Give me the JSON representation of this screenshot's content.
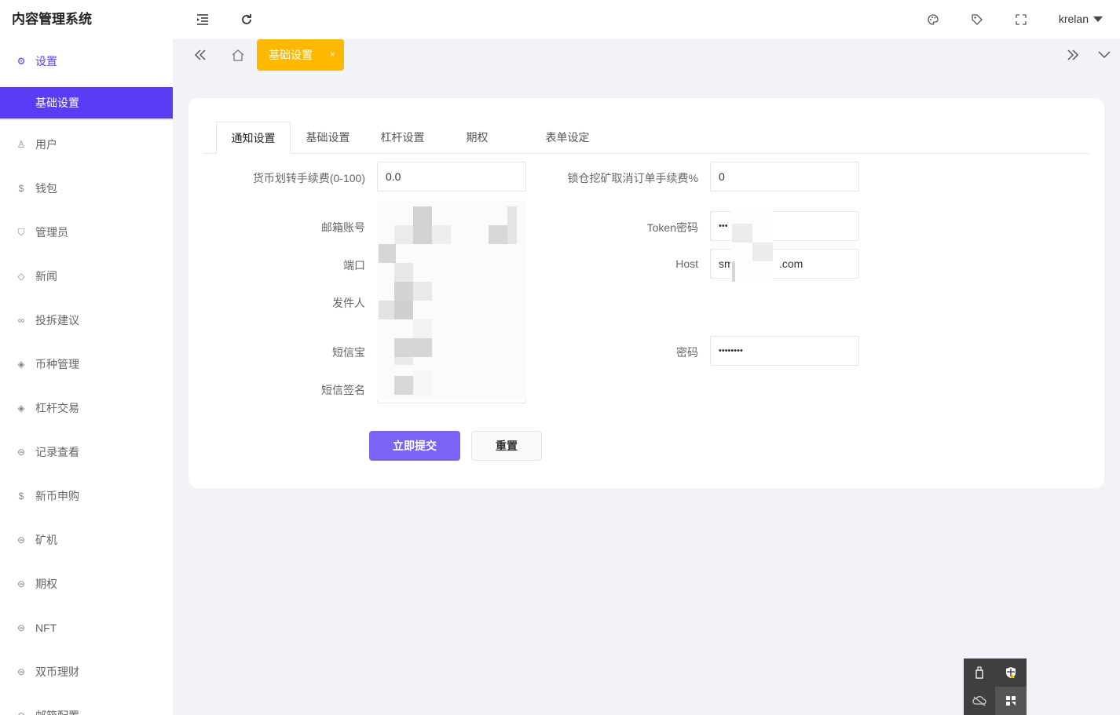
{
  "app": {
    "title": "内容管理系统"
  },
  "sidebar": {
    "top": {
      "label": "设置",
      "icon": "gear-icon"
    },
    "active_sub": "基础设置",
    "items": [
      {
        "label": "用户",
        "icon": "user-icon"
      },
      {
        "label": "钱包",
        "icon": "dollar-icon"
      },
      {
        "label": "管理员",
        "icon": "shield-icon"
      },
      {
        "label": "新闻",
        "icon": "tag-icon"
      },
      {
        "label": "投拆建议",
        "icon": "infinity-icon"
      },
      {
        "label": "币种管理",
        "icon": "diamond-icon"
      },
      {
        "label": "杠杆交易",
        "icon": "diamond-icon"
      },
      {
        "label": "记录查看",
        "icon": "circle-arrow-icon"
      },
      {
        "label": "新币申购",
        "icon": "dollar-icon"
      },
      {
        "label": "矿机",
        "icon": "circle-arrow-icon"
      },
      {
        "label": "期权",
        "icon": "circle-arrow-icon"
      },
      {
        "label": "NFT",
        "icon": "circle-arrow-icon"
      },
      {
        "label": "双币理财",
        "icon": "circle-arrow-icon"
      },
      {
        "label": "邮箱配置",
        "icon": "circle-arrow-icon"
      }
    ]
  },
  "topbar": {
    "user": "krelan"
  },
  "tabsbar": {
    "active_tab": "基础设置",
    "close": "×"
  },
  "form": {
    "tabs": [
      "通知设置",
      "基础设置",
      "杠杆设置",
      "期权",
      "表单设定"
    ],
    "fields": {
      "currency_fee": {
        "label": "货币划转手续费(0-100)",
        "value": "0.0"
      },
      "mining_fee": {
        "label": "锁仓挖矿取消订单手续费%",
        "value": "0"
      },
      "email": {
        "label": "邮箱账号",
        "value": "n"
      },
      "token_pwd": {
        "label": "Token密码",
        "value": "•••            •••••"
      },
      "port": {
        "label": "端口",
        "value": ""
      },
      "host": {
        "label": "Host",
        "value": "sm               .com"
      },
      "sender": {
        "label": "发件人",
        "value": ""
      },
      "sms": {
        "label": "短信宝",
        "value": ""
      },
      "password": {
        "label": "密码",
        "value": "••••••••"
      },
      "sms_sign": {
        "label": "短信签名",
        "value": ""
      }
    },
    "submit": "立即提交",
    "reset": "重置"
  }
}
